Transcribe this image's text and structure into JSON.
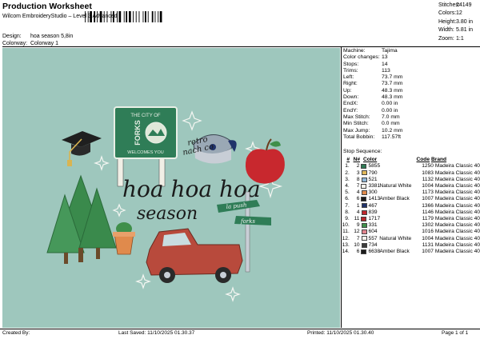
{
  "header": {
    "title": "Production Worksheet",
    "subtitle": "Wilcom EmbroideryStudio – Level 3 Advanced",
    "design_label": "Design:",
    "design_value": "hoa season 5,8in",
    "colorway_label": "Colorway:",
    "colorway_value": "Colorway 1"
  },
  "stats": [
    {
      "label": "Stitches:",
      "value": "24149"
    },
    {
      "label": "Colors:",
      "value": "12"
    },
    {
      "label": "Height:",
      "value": "3.80 in"
    },
    {
      "label": "Width:",
      "value": "5.81 in"
    },
    {
      "label": "Zoom:",
      "value": "1:1"
    }
  ],
  "machine_info": [
    {
      "label": "Machine:",
      "value": "Tajima"
    },
    {
      "label": "Color changes:",
      "value": "13"
    },
    {
      "label": "Stops:",
      "value": "14"
    },
    {
      "label": "Trims:",
      "value": "113"
    },
    {
      "label": "Left:",
      "value": "73.7 mm"
    },
    {
      "label": "Right:",
      "value": "73.7 mm"
    },
    {
      "label": "Up:",
      "value": "48.3 mm"
    },
    {
      "label": "Down:",
      "value": "48.3 mm"
    },
    {
      "label": "EndX:",
      "value": "0.00 in"
    },
    {
      "label": "EndY:",
      "value": "0.00 in"
    },
    {
      "label": "Max Stitch:",
      "value": "7.0 mm"
    },
    {
      "label": "Min Stitch:",
      "value": "0.0 mm"
    },
    {
      "label": "Max Jump:",
      "value": "10.2 mm"
    },
    {
      "label": "Total Bobbin:",
      "value": "117.57ft"
    }
  ],
  "sequence": {
    "title": "Stop Sequence:",
    "headers": {
      "idx": "#",
      "n": "N#",
      "color": "Color",
      "code": "Code",
      "brand": "Brand"
    },
    "rows": [
      {
        "idx": "1.",
        "n": "2",
        "color": "#2e7a55",
        "code": "5855",
        "name": "",
        "stitches": "1250",
        "brand": "Madeira Classic 40"
      },
      {
        "idx": "2.",
        "n": "3",
        "color": "#e0b85a",
        "code": "790",
        "name": "",
        "stitches": "1083",
        "brand": "Madeira Classic 40"
      },
      {
        "idx": "3.",
        "n": "8",
        "color": "#8fb6d6",
        "code": "521",
        "name": "",
        "stitches": "1132",
        "brand": "Madeira Classic 40"
      },
      {
        "idx": "4.",
        "n": "7",
        "color": "#f6f4ec",
        "code": "3381",
        "name": "Natural White",
        "stitches": "1004",
        "brand": "Madeira Classic 40"
      },
      {
        "idx": "5.",
        "n": "4",
        "color": "#e08a4c",
        "code": "300",
        "name": "",
        "stitches": "1173",
        "brand": "Madeira Classic 40"
      },
      {
        "idx": "6.",
        "n": "6",
        "color": "#1c1c1c",
        "code": "1413",
        "name": "Amber Black",
        "stitches": "1007",
        "brand": "Madeira Classic 40"
      },
      {
        "idx": "7.",
        "n": "1",
        "color": "#20326a",
        "code": "467",
        "name": "",
        "stitches": "1366",
        "brand": "Madeira Classic 40"
      },
      {
        "idx": "8.",
        "n": "4",
        "color": "#c0262c",
        "code": "839",
        "name": "",
        "stitches": "1146",
        "brand": "Madeira Classic 40"
      },
      {
        "idx": "9.",
        "n": "11",
        "color": "#b6282c",
        "code": "1717",
        "name": "",
        "stitches": "1179",
        "brand": "Madeira Classic 40"
      },
      {
        "idx": "10.",
        "n": "9",
        "color": "#3f8f4a",
        "code": "331",
        "name": "",
        "stitches": "1302",
        "brand": "Madeira Classic 40"
      },
      {
        "idx": "11.",
        "n": "12",
        "color": "#e2858e",
        "code": "604",
        "name": "",
        "stitches": "1016",
        "brand": "Madeira Classic 40"
      },
      {
        "idx": "12.",
        "n": "7",
        "color": "#f6f4ec",
        "code": "557",
        "name": "Natural White",
        "stitches": "1004",
        "brand": "Madeira Classic 40"
      },
      {
        "idx": "13.",
        "n": "10",
        "color": "#3c3c3c",
        "code": "734",
        "name": "",
        "stitches": "1131",
        "brand": "Madeira Classic 40"
      },
      {
        "idx": "14.",
        "n": "6",
        "color": "#1c1c1c",
        "code": "6638",
        "name": "Amber Black",
        "stitches": "1007",
        "brand": "Madeira Classic 40"
      }
    ]
  },
  "design_art": {
    "text_main": "hoa hoa hoa",
    "text_season": "season",
    "text_retro": "retro",
    "text_nach": "nach co",
    "text_city": "THE CITY OF",
    "text_forks": "FORKS",
    "text_welcome": "WELCOMES YOU",
    "text_sign1": "la push",
    "text_sign2": "forks",
    "colors": {
      "background": "#9ec7bd",
      "green": "#2f7d57",
      "tree": "#3a8a4c",
      "truck": "#b84a3c",
      "apple": "#c8282e",
      "grad": "#1f1f1f",
      "gold": "#d9b451"
    }
  },
  "footer": {
    "created_by": "Created By:",
    "last_saved": "Last Saved: 11/10/2025 01.30.37",
    "printed": "Printed: 11/10/2025 01.30.40",
    "page": "Page 1 of 1"
  }
}
